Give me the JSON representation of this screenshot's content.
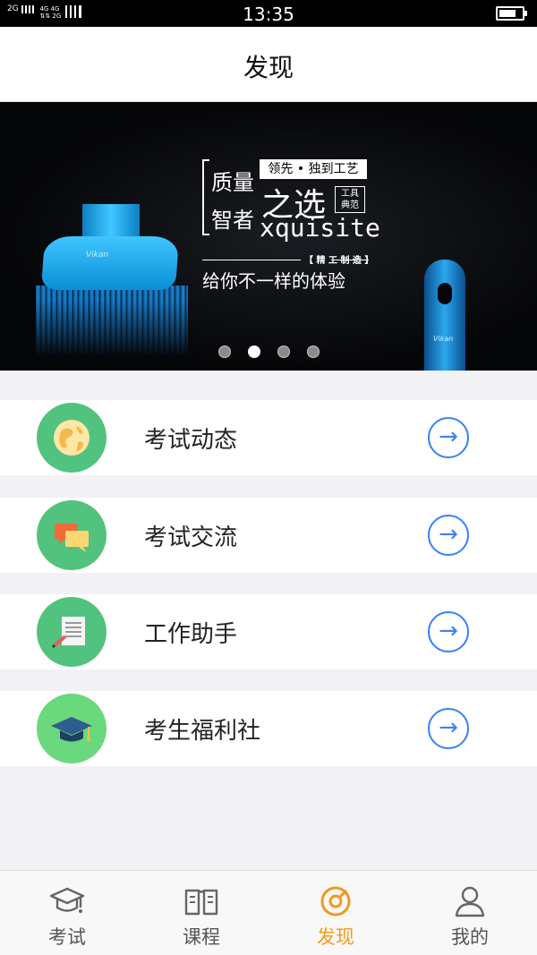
{
  "status_bar": {
    "network_left": "2G",
    "network_mid_top": "4G 4G",
    "network_mid_bottom": "⇅⇅ 2G",
    "time": "13:35",
    "battery_level": 0.75
  },
  "header": {
    "title": "发现"
  },
  "banner": {
    "brand": "Vikan",
    "text_quality": "质量",
    "text_wise": "智者",
    "tag": "领先 • 独到工艺",
    "headline": "之选",
    "box_line1": "工具",
    "box_line2": "典范",
    "word": "xquisite",
    "made": "【 精 工 制 造 】",
    "subtitle": "给你不一样的体验",
    "dots_total": 4,
    "active_dot": 2
  },
  "list": [
    {
      "label": "考试动态",
      "icon": "globe-icon",
      "color": "#52c27f"
    },
    {
      "label": "考试交流",
      "icon": "chat-bubbles-icon",
      "color": "#52c27f"
    },
    {
      "label": "工作助手",
      "icon": "document-pen-icon",
      "color": "#52c27f"
    },
    {
      "label": "考生福利社",
      "icon": "graduation-cap-icon",
      "color": "#6ad87c"
    }
  ],
  "tabbar": {
    "tabs": [
      {
        "label": "考试",
        "icon": "mortarboard-icon"
      },
      {
        "label": "课程",
        "icon": "book-icon"
      },
      {
        "label": "发现",
        "icon": "compass-icon"
      },
      {
        "label": "我的",
        "icon": "person-icon"
      }
    ],
    "active_index": 2,
    "active_color": "#f39a1c"
  }
}
